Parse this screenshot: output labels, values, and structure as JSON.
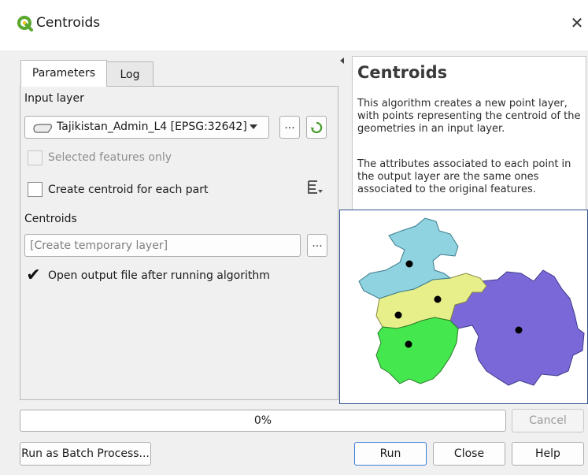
{
  "window": {
    "title": "Centroids"
  },
  "tabs": [
    {
      "label": "Parameters"
    },
    {
      "label": "Log"
    }
  ],
  "params": {
    "input_layer_label": "Input layer",
    "input_layer_value": "Tajikistan_Admin_L4 [EPSG:32642]",
    "browse_label": "...",
    "selected_only_label": "Selected features only",
    "selected_only_checked": false,
    "each_part_label": "Create centroid for each part",
    "each_part_checked": false,
    "centroids_label": "Centroids",
    "output_placeholder": "[Create temporary layer]",
    "output_browse_label": "...",
    "open_output_label": "Open output file after running algorithm",
    "open_output_checked": true,
    "check_mark": "✔"
  },
  "help": {
    "title": "Centroids",
    "p1": "This algorithm creates a new point layer, with points representing the centroid of the geometries in an input layer.",
    "p2": "The attributes associated to each point in the output layer are the same ones associated to the original features."
  },
  "progress": {
    "value": 0,
    "text": "0%"
  },
  "buttons": {
    "cancel": "Cancel",
    "batch": "Run as Batch Process...",
    "run": "Run",
    "close": "Close",
    "help": "Help"
  },
  "colors": {
    "region_north": "#8fd3e0",
    "region_center": "#e6ef8a",
    "region_southwest": "#44e84e",
    "region_east": "#7b68d8",
    "qgis_green": "#5aa82e",
    "qgis_yellow": "#f0c61a"
  }
}
